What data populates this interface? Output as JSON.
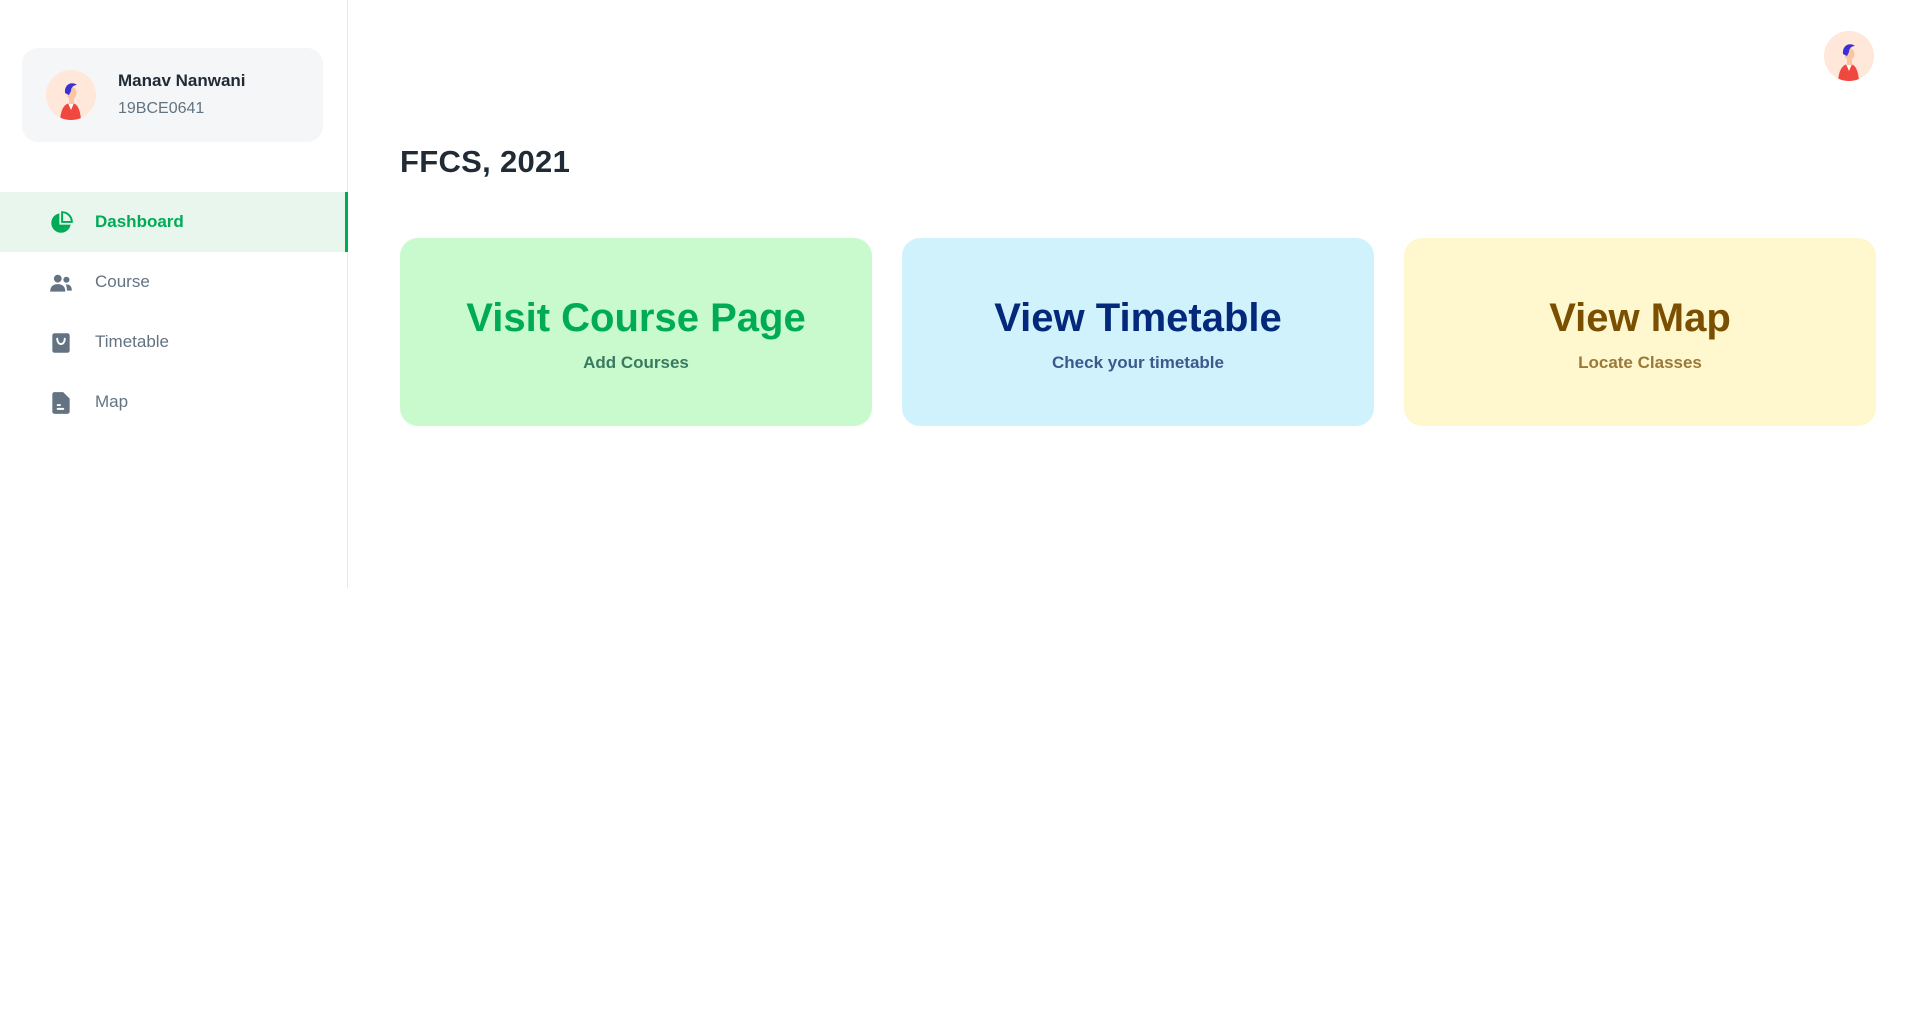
{
  "colors": {
    "accent": "#00ab55",
    "active_bg": "#e9f6ee",
    "card_green": "#c8facd",
    "card_blue": "#d0f2fc",
    "card_yellow": "#fff7cd"
  },
  "account": {
    "name": "Manav Nanwani",
    "id": "19BCE0641",
    "avatar_icon": "person-avatar-icon"
  },
  "sidebar": {
    "items": [
      {
        "label": "Dashboard",
        "icon": "pie-chart-icon",
        "active": true
      },
      {
        "label": "Course",
        "icon": "people-icon",
        "active": false
      },
      {
        "label": "Timetable",
        "icon": "shopping-bag-icon",
        "active": false
      },
      {
        "label": "Map",
        "icon": "file-text-icon",
        "active": false
      }
    ]
  },
  "header": {
    "avatar_icon": "person-avatar-icon"
  },
  "main": {
    "title": "FFCS, 2021",
    "cards": [
      {
        "title": "Visit Course Page",
        "subtitle": "Add Courses"
      },
      {
        "title": "View Timetable",
        "subtitle": "Check your timetable"
      },
      {
        "title": "View Map",
        "subtitle": "Locate Classes"
      }
    ]
  }
}
